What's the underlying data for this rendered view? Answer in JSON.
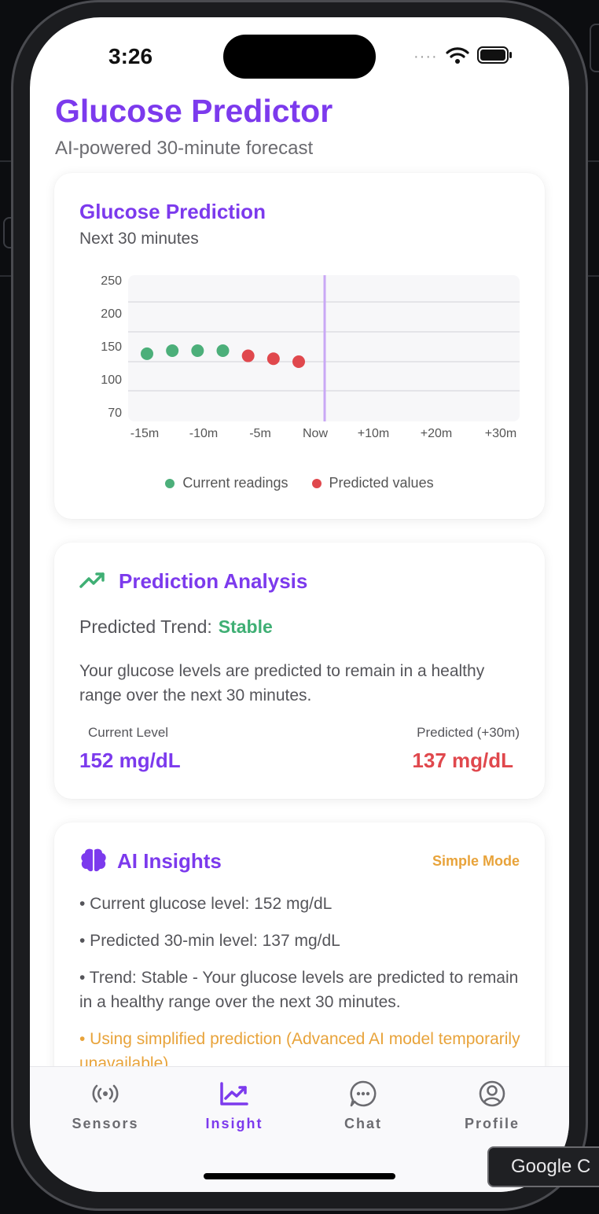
{
  "status": {
    "time": "3:26"
  },
  "header": {
    "title": "Glucose Predictor",
    "subtitle": "AI-powered 30-minute forecast"
  },
  "prediction_card": {
    "title": "Glucose Prediction",
    "subtitle": "Next 30 minutes",
    "legend": {
      "current": "Current readings",
      "predicted": "Predicted values"
    }
  },
  "chart_data": {
    "type": "scatter",
    "y_ticks": [
      "250",
      "200",
      "150",
      "100",
      "70"
    ],
    "x_ticks": [
      "-15m",
      "-10m",
      "-5m",
      "Now",
      "+10m",
      "+20m",
      "+30m"
    ],
    "ylim": [
      70,
      250
    ],
    "series": [
      {
        "name": "Current readings",
        "color": "#4caf7a",
        "x": [
          -15,
          -12.5,
          -10,
          -7.5
        ],
        "y": [
          150,
          152,
          152,
          152
        ]
      },
      {
        "name": "Predicted values",
        "color": "#e0484d",
        "x": [
          -5,
          -2.5,
          0
        ],
        "y": [
          145,
          141,
          137
        ]
      }
    ],
    "now_marker": "Now",
    "now_marker_color": "#c9a8f5",
    "grid": true
  },
  "analysis_card": {
    "title": "Prediction Analysis",
    "icon": "trending-up-icon",
    "trend_label": "Predicted Trend:",
    "trend_value": "Stable",
    "description": "Your glucose levels are predicted to remain in a healthy range over the next 30 minutes.",
    "current_label": "Current Level",
    "current_value": "152 mg/dL",
    "predicted_label": "Predicted (+30m)",
    "predicted_value": "137 mg/dL"
  },
  "insights_card": {
    "title": "AI Insights",
    "icon": "brain-icon",
    "mode": "Simple Mode",
    "items": [
      "• Current glucose level: 152 mg/dL",
      "• Predicted 30-min level: 137 mg/dL",
      "• Trend: Stable - Your glucose levels are predicted to remain in a healthy range over the next 30 minutes.",
      "• Using simplified prediction (Advanced AI model temporarily unavailable)"
    ]
  },
  "tabbar": {
    "tabs": [
      {
        "label": "Sensors",
        "icon": "sensor-icon"
      },
      {
        "label": "Insight",
        "icon": "chart-icon"
      },
      {
        "label": "Chat",
        "icon": "chat-icon"
      },
      {
        "label": "Profile",
        "icon": "profile-icon"
      }
    ],
    "active": "Insight"
  },
  "tooltip": {
    "text": "Google C"
  },
  "colors": {
    "accent": "#7c3aed",
    "green": "#3faf74",
    "red": "#e0484d",
    "orange": "#e8a33a"
  }
}
